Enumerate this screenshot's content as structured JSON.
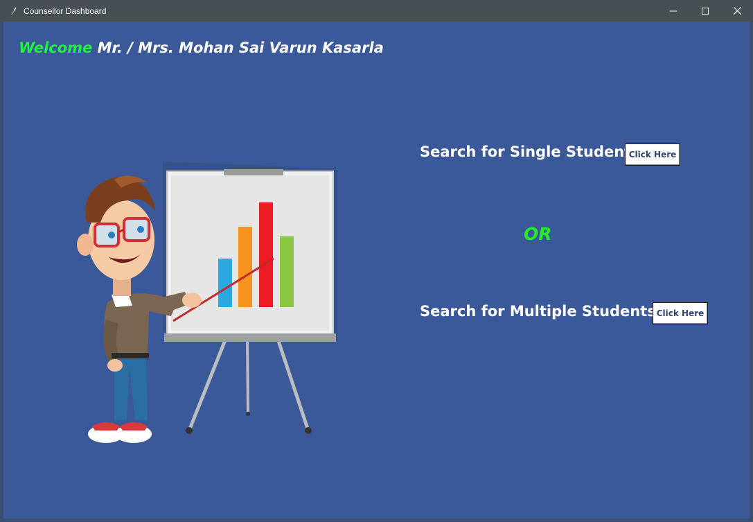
{
  "window": {
    "title": "Counsellor Dashboard",
    "controls": [
      "minimize-icon",
      "maximize-icon",
      "close-icon"
    ]
  },
  "header": {
    "welcome_word": "Welcome",
    "user_name": " Mr. / Mrs. Mohan Sai Varun Kasarla"
  },
  "single": {
    "label": "Search for Single Student :",
    "button_label": "Click Here"
  },
  "separator": {
    "text": "OR"
  },
  "multiple": {
    "label": "Search for Multiple Students :",
    "button_label": "Click Here"
  },
  "illustration": {
    "icon": "teacher-with-chart-illustration",
    "bar_colors": [
      "#29a9e0",
      "#f7941d",
      "#ed1c24",
      "#8dc63f"
    ]
  },
  "colors": {
    "background": "#3b5998",
    "accent_green": "#22ee44",
    "text": "#ffffff"
  }
}
